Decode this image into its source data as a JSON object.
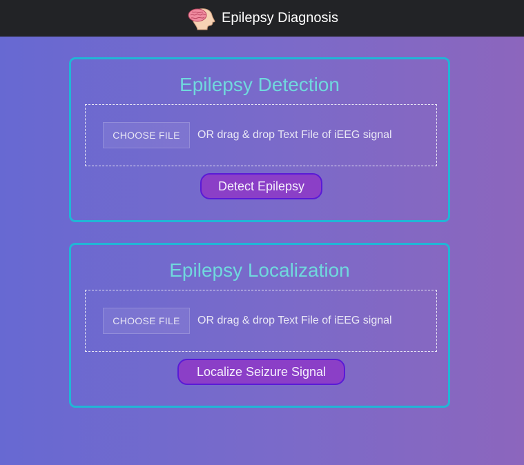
{
  "navbar": {
    "brand_title": "Epilepsy Diagnosis",
    "brand_icon": "brain-head-icon"
  },
  "detection": {
    "title": "Epilepsy Detection",
    "choose_file_label": "CHOOSE FILE",
    "drop_hint": "OR drag & drop Text File of iEEG signal",
    "action_label": "Detect Epilepsy"
  },
  "localization": {
    "title": "Epilepsy Localization",
    "choose_file_label": "CHOOSE FILE",
    "drop_hint": "OR drag & drop Text File of iEEG signal",
    "action_label": "Localize Seizure Signal"
  },
  "colors": {
    "navbar_bg": "#222326",
    "card_border": "#21b6d6",
    "title_color": "#70d8dd",
    "button_bg": "#8b3fc7",
    "button_border": "#5a1ad6"
  }
}
